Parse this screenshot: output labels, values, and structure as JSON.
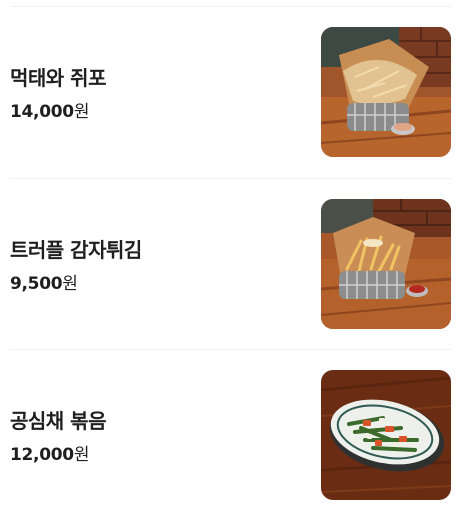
{
  "menu": {
    "items": [
      {
        "name": "먹태와 쥐포",
        "price": "14,000",
        "currency": "원",
        "photo": "fried-snack-basket-photo"
      },
      {
        "name": "트러플 감자튀김",
        "price": "9,500",
        "currency": "원",
        "photo": "truffle-fries-basket-photo"
      },
      {
        "name": "공심채 볶음",
        "price": "12,000",
        "currency": "원",
        "photo": "stir-fried-greens-plate-photo"
      }
    ]
  }
}
